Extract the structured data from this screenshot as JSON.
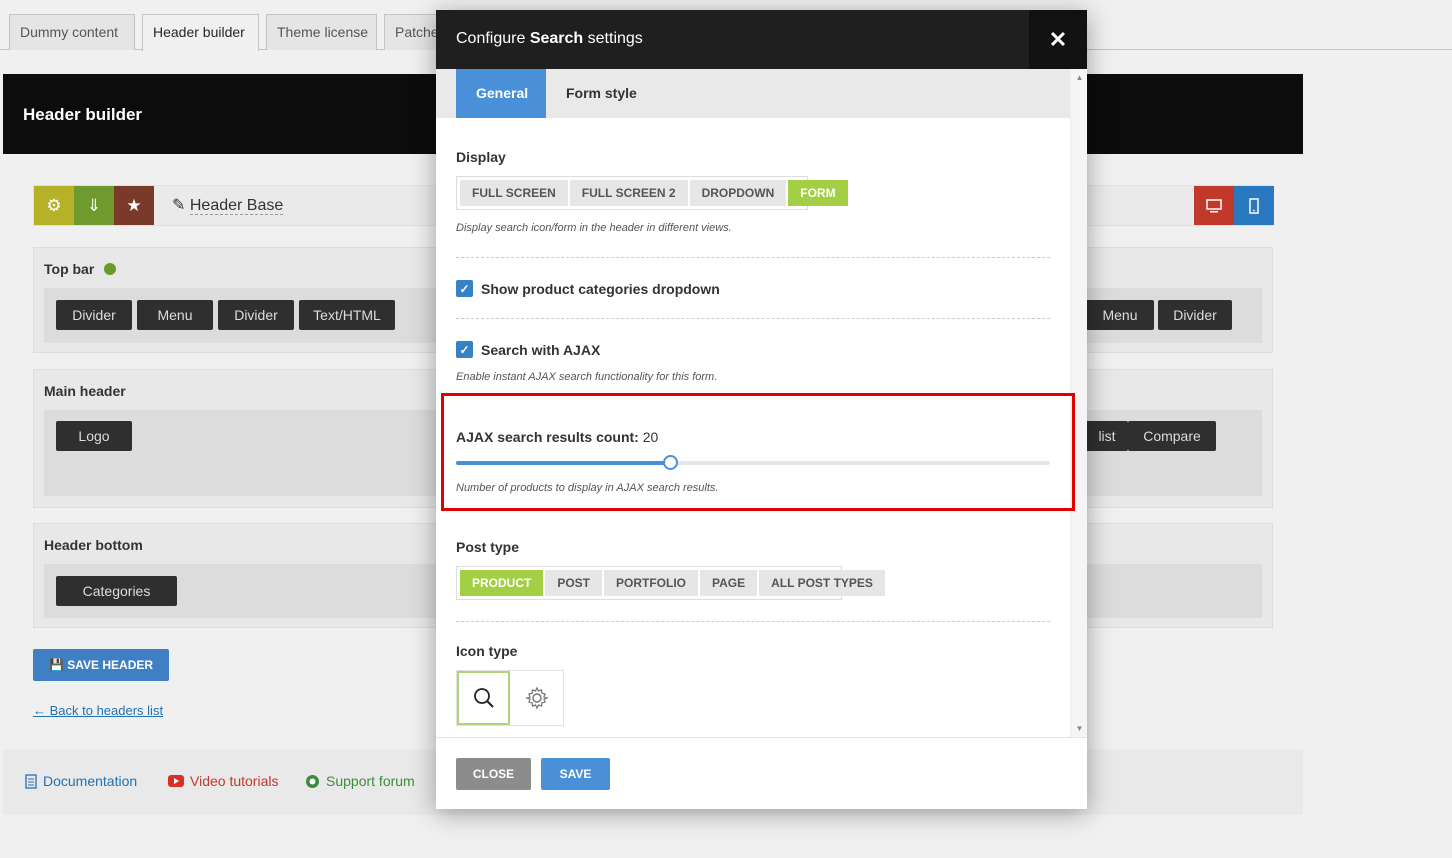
{
  "page_tabs": [
    "Dummy content",
    "Header builder",
    "Theme license",
    "Patches"
  ],
  "active_tab": "Header builder",
  "header_builder": {
    "title": "Header builder",
    "header_name": "Header Base",
    "rows": {
      "top_bar": {
        "label": "Top bar",
        "left_elements": [
          "Divider",
          "Menu",
          "Divider",
          "Text/HTML"
        ],
        "right_elements": [
          "Menu",
          "Divider"
        ]
      },
      "main_header": {
        "label": "Main header",
        "left_elements": [
          "Logo"
        ],
        "right_elements": [
          "list",
          "Compare"
        ]
      },
      "header_bottom": {
        "label": "Header bottom",
        "left_elements": [
          "Categories"
        ]
      }
    },
    "save_label": "SAVE HEADER",
    "back_link": "← Back to headers list"
  },
  "footer": {
    "documentation": "Documentation",
    "video_tutorials": "Video tutorials",
    "support_forum": "Support forum"
  },
  "modal": {
    "title_prefix": "Configure ",
    "title_bold": "Search",
    "title_suffix": " settings",
    "tabs": [
      "General",
      "Form style"
    ],
    "display": {
      "label": "Display",
      "options": [
        "FULL SCREEN",
        "FULL SCREEN 2",
        "DROPDOWN",
        "FORM"
      ],
      "selected": "FORM",
      "hint": "Display search icon/form in the header in different views."
    },
    "show_categories": {
      "label": "Show product categories dropdown",
      "checked": true
    },
    "search_ajax": {
      "label": "Search with AJAX",
      "checked": true,
      "hint": "Enable instant AJAX search functionality for this form."
    },
    "ajax_count": {
      "label": "AJAX search results count:",
      "value": "20",
      "fraction": 0.36,
      "hint": "Number of products to display in AJAX search results."
    },
    "post_type": {
      "label": "Post type",
      "options": [
        "PRODUCT",
        "POST",
        "PORTFOLIO",
        "PAGE",
        "ALL POST TYPES"
      ],
      "selected": "PRODUCT"
    },
    "icon_type": {
      "label": "Icon type"
    },
    "close_label": "CLOSE",
    "save_label": "SAVE",
    "close_x": "✕"
  },
  "colors": {
    "accent_blue": "#4a90d9",
    "active_green": "#a2cf44",
    "highlight_red": "#e00000"
  }
}
